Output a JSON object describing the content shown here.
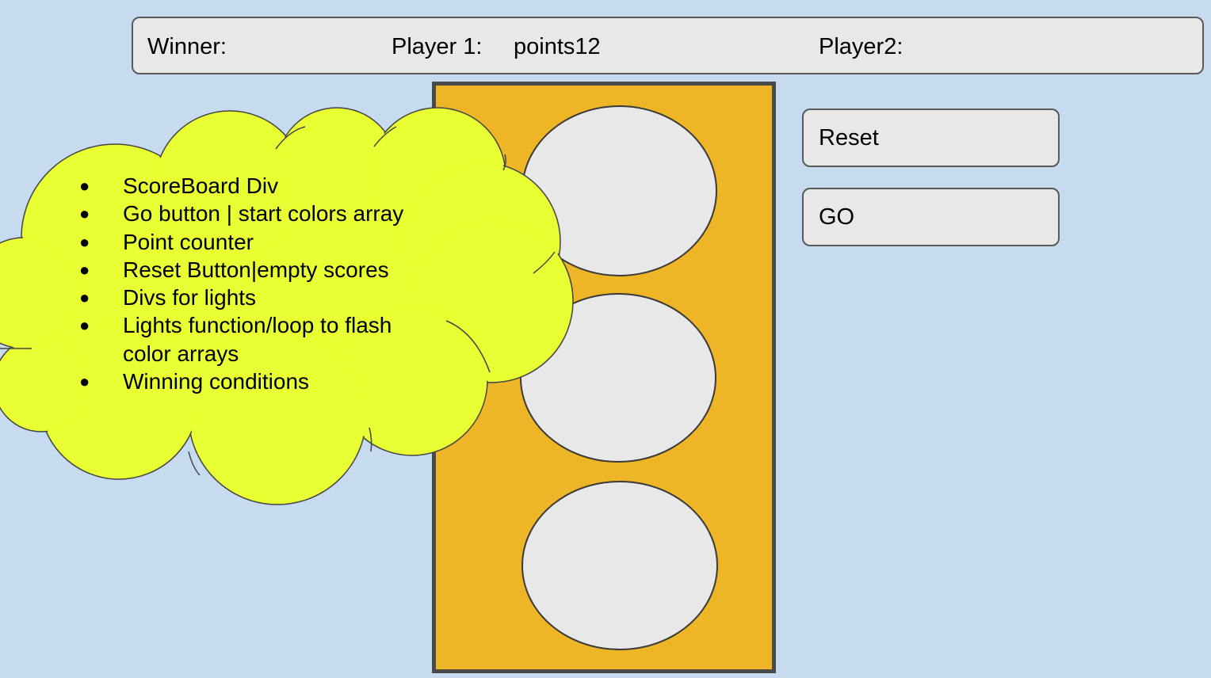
{
  "scoreboard": {
    "winner_label": "Winner:",
    "player1_label": "Player 1:",
    "player1_points": "points12",
    "player2_label": "Player2:"
  },
  "buttons": {
    "reset_label": "Reset",
    "go_label": "GO"
  },
  "notes": {
    "bullet": "●",
    "items": [
      "ScoreBoard Div",
      "Go button | start colors array",
      "Point counter",
      "Reset Button|empty scores",
      "Divs for lights",
      "Lights function/loop to flash color arrays",
      "Winning conditions"
    ]
  },
  "colors": {
    "background": "#c6dbef",
    "panel": "#eeb526",
    "cloud": "#e8ff33",
    "light_off": "#e8e8e8"
  }
}
